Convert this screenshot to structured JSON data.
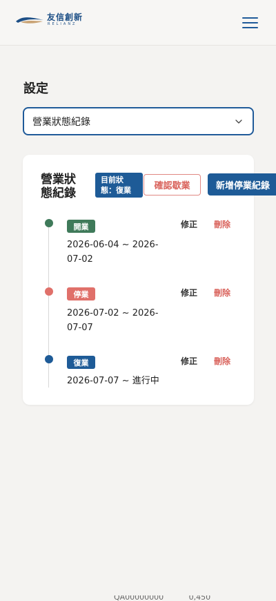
{
  "header": {
    "logo_cn": "友信創新",
    "logo_en": "RELIANZ",
    "menu_icon": "hamburger-menu-icon",
    "brand_color": "#1e5b97"
  },
  "page": {
    "title": "設定"
  },
  "selector": {
    "value": "營業狀態紀錄",
    "icon": "chevron-down-icon"
  },
  "card": {
    "title": "營業狀態紀錄",
    "status_badge": "目前狀態：復業",
    "reopen_button": "確認歇業",
    "add_button": "新增停業紀錄",
    "records": [
      {
        "tag": "開業",
        "tag_color": "#3f7a5a",
        "dot_color": "#3f7a5a",
        "period": "2026-06-04 ~ 2026-07-02",
        "edit": "修正",
        "delete": "刪除"
      },
      {
        "tag": "停業",
        "tag_color": "#e0706a",
        "dot_color": "#e0706a",
        "period": "2026-07-02 ~ 2026-07-07",
        "edit": "修正",
        "delete": "刪除"
      },
      {
        "tag": "復業",
        "tag_color": "#1e5b97",
        "dot_color": "#1e5b97",
        "period": "2026-07-07 ~ 進行中",
        "edit": "修正",
        "delete": "刪除"
      }
    ]
  },
  "footer": {
    "text": "QA00000000 　　　0,450"
  }
}
